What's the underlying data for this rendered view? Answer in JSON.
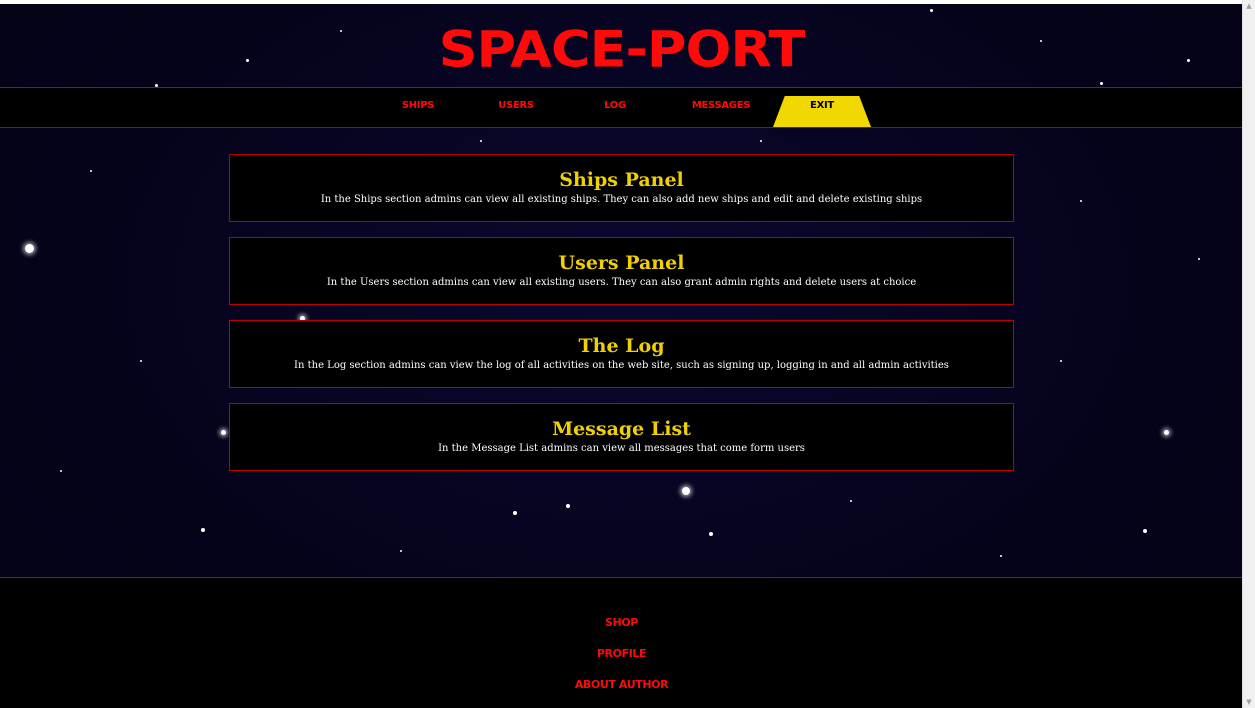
{
  "logo": {
    "text": "SPACE-PORT"
  },
  "nav": {
    "ships": "SHIPS",
    "users": "USERS",
    "log": "LOG",
    "messages": "MESSAGES",
    "exit": "EXIT"
  },
  "panels": [
    {
      "title": "Ships Panel",
      "description": "In the Ships section admins can view all existing ships. They can also add new ships and edit and delete existing ships"
    },
    {
      "title": "Users Panel",
      "description": "In the Users section admins can view all existing users. They can also grant admin rights and delete users at choice"
    },
    {
      "title": "The Log",
      "description": "In the Log section admins can view the log of all activities on the web site, such as signing up, logging in and all admin activities"
    },
    {
      "title": "Message List",
      "description": "In the Message List admins can view all messages that come form users"
    }
  ],
  "footer": {
    "shop": "SHOP",
    "profile": "PROFILE",
    "about": "ABOUT AUTHOR"
  },
  "colors": {
    "accent_red": "#ff0a0a",
    "border_red": "#c00000",
    "title_yellow": "#f0d000",
    "exit_tab_yellow": "#f0d800",
    "background": "#05031a"
  }
}
